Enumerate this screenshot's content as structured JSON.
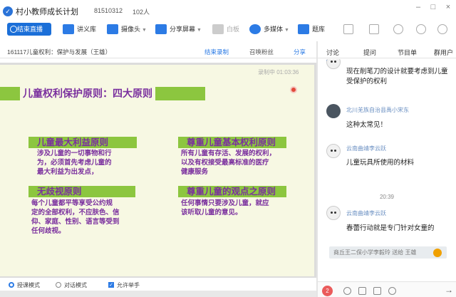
{
  "window": {
    "title": "村小教师成长计划",
    "room_id": "81510312",
    "member_count": "102人",
    "controls": [
      "minimize-icon",
      "maximize-icon",
      "close-icon"
    ]
  },
  "toolbar": {
    "end_live_label": "结束直播",
    "items": [
      {
        "label": "讲义库",
        "icon": "document-icon"
      },
      {
        "label": "摄像头",
        "icon": "camera-icon"
      },
      {
        "label": "分享屏幕",
        "icon": "screen-share-icon"
      },
      {
        "label": "白板",
        "icon": "whiteboard-icon",
        "disabled": true
      },
      {
        "label": "多媒体",
        "icon": "multimedia-icon"
      },
      {
        "label": "题库",
        "icon": "question-bank-icon"
      }
    ],
    "right_icons": [
      "bag-icon",
      "folder-icon",
      "share-icon",
      "settings-icon",
      "more-icon"
    ]
  },
  "subbar": {
    "course_title": "161117儿童权利：保护与发展（王雄）",
    "end_record": "结束录制",
    "summon_fans": "召唤粉丝",
    "share": "分享"
  },
  "slide": {
    "timer": "录制中 01:03:36",
    "title": "儿童权利保护原则：四大原则",
    "sections": [
      {
        "heading": "儿童最大利益原则",
        "body": [
          "涉及儿童的一切事物和行",
          "为，必须首先考虑儿童的",
          "最大利益为出发点，"
        ]
      },
      {
        "heading": "无歧视原则",
        "body": [
          "每个儿童都平等享受公约规",
          "定的全部权利，不应肤色、信",
          "仰、家庭、性别、语言等受到",
          "任何歧视。"
        ]
      },
      {
        "heading": "尊重儿童基本权利原则",
        "body": [
          "所有儿童有存活、发展的权利，",
          "以及有权接受最高标准的医疗",
          "健康服务"
        ]
      },
      {
        "heading": "尊重儿童的观点之原则",
        "body": [
          "任何事情只要涉及儿童，就应",
          "该听取儿童的意见。"
        ]
      }
    ]
  },
  "modebar": {
    "lecture_mode": "授课模式",
    "dialog_mode": "对话模式",
    "allow_raise_hand": "允许举手"
  },
  "panel": {
    "tabs": [
      "讨论",
      "提问",
      "节目单",
      "群用户"
    ],
    "messages": [
      {
        "sender": "",
        "text": [
          "现在削笔刀的设计就要考虑到儿童",
          "受保护的权利"
        ]
      },
      {
        "sender": "北川羌族自治县禹小宋东",
        "text": [
          "这种太常见！"
        ]
      },
      {
        "sender": "云南曲靖李云跃",
        "text": [
          "儿童玩具所使用的材料"
        ]
      },
      {
        "time": "20:39"
      },
      {
        "sender": "云南曲靖李云跃",
        "text": [
          "春蕾行动就是专门针对女童的"
        ]
      }
    ],
    "notice": "商丘王二保小学李毅玲 送给 王雄",
    "gift_count": "2"
  },
  "colors": {
    "accent": "#1b6fd8",
    "slide_green": "#8cc63f",
    "slide_purple": "#7a2f9e",
    "slide_bg": "#f7f8e3"
  }
}
